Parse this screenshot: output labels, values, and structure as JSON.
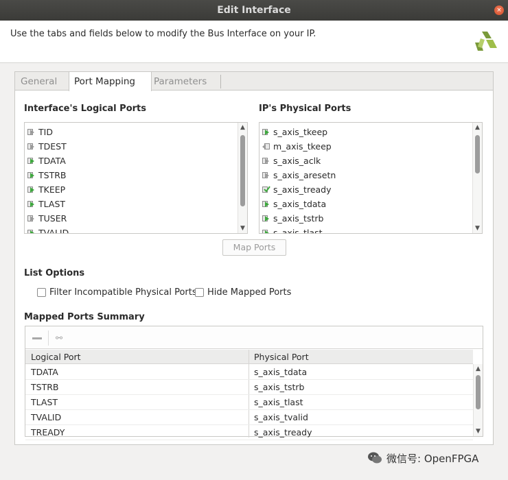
{
  "window": {
    "title": "Edit Interface",
    "close_glyph": "×"
  },
  "header": {
    "description": "Use the tabs and fields below to modify the Bus Interface on your IP.",
    "logo_icon": "xilinx-logo-icon"
  },
  "tabs": [
    {
      "label": "General",
      "active": false
    },
    {
      "label": "Port Mapping",
      "active": true
    },
    {
      "label": "Parameters",
      "active": false
    }
  ],
  "logical_ports": {
    "title": "Interface's Logical Ports",
    "items": [
      {
        "label": "TID",
        "icon": "port-in"
      },
      {
        "label": "TDEST",
        "icon": "port-in"
      },
      {
        "label": "TDATA",
        "icon": "port-in-green"
      },
      {
        "label": "TSTRB",
        "icon": "port-in-green"
      },
      {
        "label": "TKEEP",
        "icon": "port-in-green"
      },
      {
        "label": "TLAST",
        "icon": "port-in-green"
      },
      {
        "label": "TUSER",
        "icon": "port-in"
      },
      {
        "label": "TVALID",
        "icon": "port-in-green"
      }
    ]
  },
  "physical_ports": {
    "title": "IP's Physical Ports",
    "items": [
      {
        "label": "s_axis_tkeep",
        "icon": "port-in-green"
      },
      {
        "label": "m_axis_tkeep",
        "icon": "port-out"
      },
      {
        "label": "s_axis_aclk",
        "icon": "port-in"
      },
      {
        "label": "s_axis_aresetn",
        "icon": "port-in"
      },
      {
        "label": "s_axis_tready",
        "icon": "port-check-green"
      },
      {
        "label": "s_axis_tdata",
        "icon": "port-in-green"
      },
      {
        "label": "s_axis_tstrb",
        "icon": "port-in-green"
      },
      {
        "label": "s_axis_tlast",
        "icon": "port-in-green"
      }
    ]
  },
  "map_ports_button": "Map Ports",
  "list_options": {
    "title": "List Options",
    "filter_label": "Filter Incompatible Physical Ports",
    "hide_label": "Hide Mapped Ports"
  },
  "summary": {
    "title": "Mapped Ports Summary",
    "columns": [
      "Logical Port",
      "Physical Port"
    ],
    "rows": [
      [
        "TDATA",
        "s_axis_tdata"
      ],
      [
        "TSTRB",
        "s_axis_tstrb"
      ],
      [
        "TLAST",
        "s_axis_tlast"
      ],
      [
        "TVALID",
        "s_axis_tvalid"
      ],
      [
        "TREADY",
        "s_axis_tready"
      ]
    ]
  },
  "watermark": {
    "text": "微信号: OpenFPGA"
  },
  "colors": {
    "accent_green": "#3fa83f",
    "titlebar": "#3b3b38",
    "close": "#d14f2a"
  }
}
